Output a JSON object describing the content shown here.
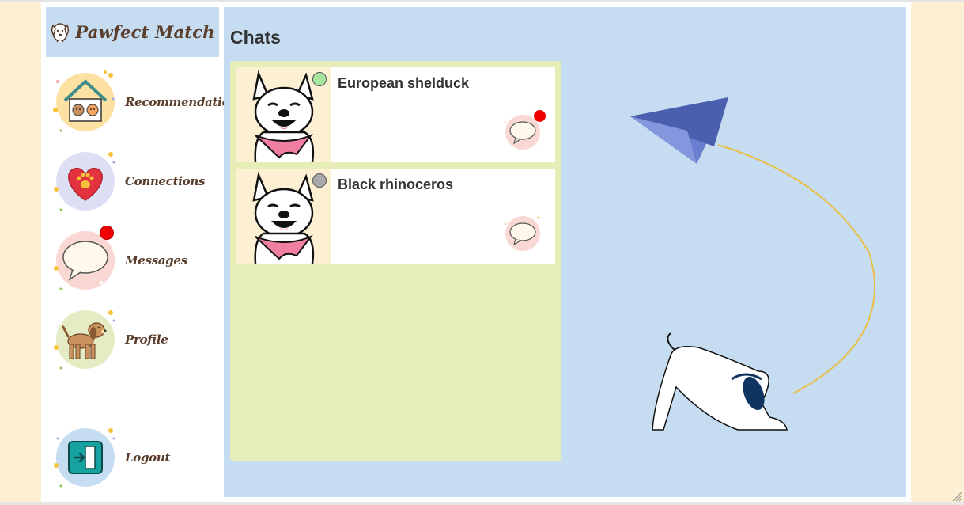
{
  "app": {
    "name": "Pawfect Match",
    "colors": {
      "background": "#fdefd2",
      "panel": "#c5dcf1",
      "chat_list": "#e6edb7",
      "text_brown": "#5a3d2b",
      "badge": "#f00000",
      "online": "#a8e6a0",
      "offline": "#a9a9a9"
    }
  },
  "sidebar": {
    "items": [
      {
        "label": "Recommendations",
        "icon": "house-pets-icon",
        "has_badge": false
      },
      {
        "label": "Connections",
        "icon": "heart-paw-icon",
        "has_badge": false
      },
      {
        "label": "Messages",
        "icon": "speech-bubble-icon",
        "has_badge": true
      },
      {
        "label": "Profile",
        "icon": "dog-icon",
        "has_badge": false
      },
      {
        "label": "Logout",
        "icon": "exit-door-icon",
        "has_badge": false
      }
    ]
  },
  "main": {
    "title": "Chats",
    "chats": [
      {
        "name": "European shelduck",
        "status": "online",
        "unread": true,
        "avatar": "white-dog-bandana-icon"
      },
      {
        "name": "Black rhinoceros",
        "status": "offline",
        "unread": false,
        "avatar": "white-dog-bandana-icon"
      }
    ],
    "decoration": [
      "paper-plane-icon",
      "playful-dog-illustration"
    ]
  }
}
